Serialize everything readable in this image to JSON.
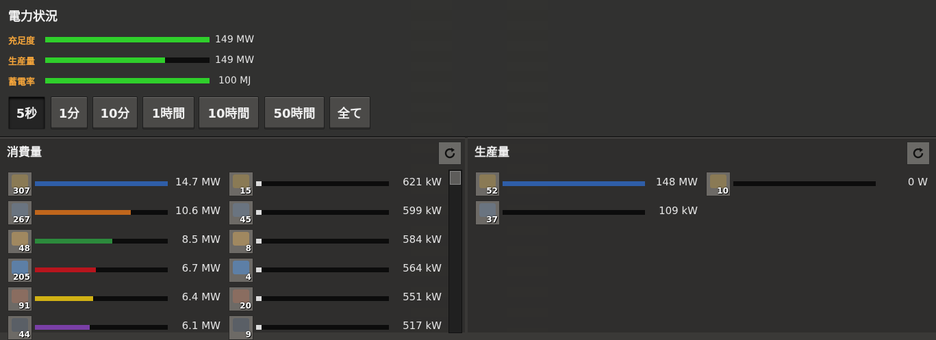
{
  "window_title": "電力状況",
  "stats": [
    {
      "label": "充足度",
      "fill": 1.0,
      "value": "149 MW"
    },
    {
      "label": "生産量",
      "fill": 0.73,
      "value": "149 MW"
    },
    {
      "label": "蓄電率",
      "fill": 1.0,
      "value": "100 MJ"
    }
  ],
  "time_buttons": [
    {
      "label": "5秒",
      "active": true
    },
    {
      "label": "1分",
      "active": false
    },
    {
      "label": "10分",
      "active": false
    },
    {
      "label": "1時間",
      "active": false
    },
    {
      "label": "10時間",
      "active": false
    },
    {
      "label": "50時間",
      "active": false
    },
    {
      "label": "全て",
      "active": false
    }
  ],
  "consumption": {
    "title": "消費量",
    "left_column": [
      {
        "count": "307",
        "value": "14.7 MW",
        "fill": 1.0,
        "color": "#2f5ea8",
        "icon": "lab-icon"
      },
      {
        "count": "267",
        "value": "10.6 MW",
        "fill": 0.72,
        "color": "#c0661c",
        "icon": "assembler-icon"
      },
      {
        "count": "48",
        "value": "8.5 MW",
        "fill": 0.58,
        "color": "#2c8a3c",
        "icon": "beacon-icon"
      },
      {
        "count": "205",
        "value": "6.7 MW",
        "fill": 0.46,
        "color": "#b8151d",
        "icon": "inserter-icon"
      },
      {
        "count": "91",
        "value": "6.4 MW",
        "fill": 0.44,
        "color": "#d1b114",
        "icon": "furnace-icon"
      },
      {
        "count": "44",
        "value": "6.1 MW",
        "fill": 0.41,
        "color": "#7a3fa6",
        "icon": "drill-icon"
      }
    ],
    "right_column": [
      {
        "count": "15",
        "value": "621 kW",
        "fill": 0.04,
        "color": "#dddddd",
        "icon": "refinery-icon"
      },
      {
        "count": "45",
        "value": "599 kW",
        "fill": 0.04,
        "color": "#dddddd",
        "icon": "chemical-plant-icon"
      },
      {
        "count": "8",
        "value": "584 kW",
        "fill": 0.04,
        "color": "#dddddd",
        "icon": "centrifuge-icon"
      },
      {
        "count": "4",
        "value": "564 kW",
        "fill": 0.04,
        "color": "#dddddd",
        "icon": "pump-icon"
      },
      {
        "count": "20",
        "value": "551 kW",
        "fill": 0.04,
        "color": "#dddddd",
        "icon": "radar-icon"
      },
      {
        "count": "9",
        "value": "517 kW",
        "fill": 0.04,
        "color": "#dddddd",
        "icon": "roboport-icon"
      }
    ]
  },
  "production": {
    "title": "生産量",
    "left_column": [
      {
        "count": "52",
        "value": "148 MW",
        "fill": 1.0,
        "color": "#2f5ea8",
        "icon": "steam-engine-icon"
      },
      {
        "count": "37",
        "value": "109 kW",
        "fill": 0.0,
        "color": "#2f5ea8",
        "icon": "solar-panel-icon"
      }
    ],
    "right_column": [
      {
        "count": "10",
        "value": "0 W",
        "fill": 0.0,
        "color": "#2f5ea8",
        "icon": "accumulator-icon"
      }
    ]
  }
}
